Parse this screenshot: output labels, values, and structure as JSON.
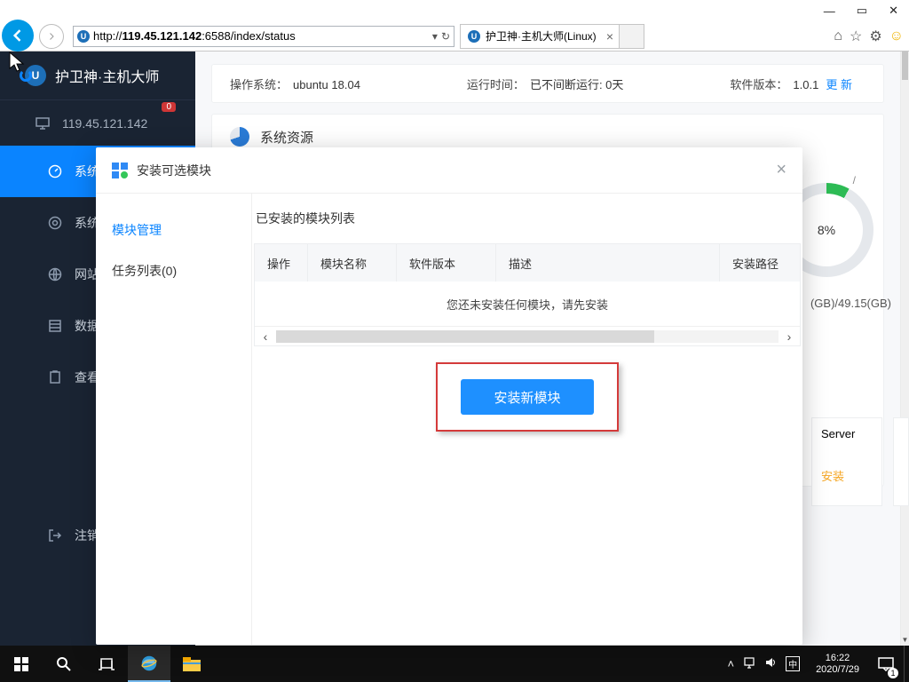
{
  "window": {
    "min": "—",
    "max": "▭",
    "close": "✕"
  },
  "browser": {
    "url_prefix": "http://",
    "url_bold": "119.45.121.142",
    "url_suffix": ":6588/index/status",
    "tab_title": "护卫神·主机大师(Linux)",
    "icons": {
      "home": "⌂",
      "fav": "☆",
      "gear": "⚙",
      "face": "☺"
    }
  },
  "sidebar": {
    "brand": "护卫神·主机大师",
    "ip": "119.45.121.142",
    "badge": "0",
    "items": [
      "系统",
      "系统",
      "网站",
      "数据",
      "查看",
      "注销"
    ]
  },
  "info": {
    "os_label": "操作系统：",
    "os_value": "ubuntu 18.04",
    "uptime_label": "运行时间：",
    "uptime_value": "已不间断运行: 0天",
    "ver_label": "软件版本：",
    "ver_value": "1.0.1",
    "update": "更 新"
  },
  "resource": {
    "title": "系统资源",
    "donut_pct": "8%",
    "disk": "(GB)/49.15(GB)",
    "tick": "/"
  },
  "server_card": {
    "name": "Server",
    "action": "安装"
  },
  "modal": {
    "title": "安装可选模块",
    "tabs": {
      "manage": "模块管理",
      "tasks": "任务列表(0)"
    },
    "subtitle": "已安装的模块列表",
    "cols": {
      "op": "操作",
      "name": "模块名称",
      "ver": "软件版本",
      "desc": "描述",
      "path": "安装路径"
    },
    "empty": "您还未安装任何模块，请先安装",
    "cta": "安装新模块"
  },
  "taskbar": {
    "time": "16:22",
    "date": "2020/7/29",
    "ime": "中",
    "notif": "1"
  }
}
